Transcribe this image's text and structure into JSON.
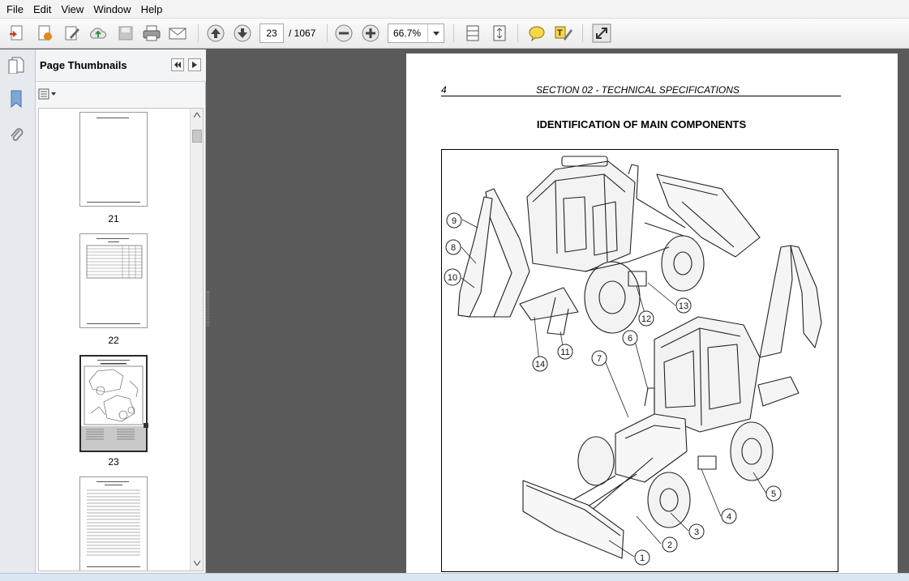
{
  "menu": [
    "File",
    "Edit",
    "View",
    "Window",
    "Help"
  ],
  "toolbar": {
    "current_page": "23",
    "total_pages": "/  1067",
    "zoom": "66.7%"
  },
  "panel": {
    "title": "Page Thumbnails"
  },
  "thumbnails": [
    {
      "label": "21"
    },
    {
      "label": "22"
    },
    {
      "label": "23"
    }
  ],
  "document": {
    "page_number": "4",
    "section_header": "SECTION 02 - TECHNICAL SPECIFICATIONS",
    "title": "IDENTIFICATION OF MAIN COMPONENTS",
    "callouts": [
      "1",
      "2",
      "3",
      "4",
      "5",
      "6",
      "7",
      "8",
      "9",
      "10",
      "11",
      "12",
      "13",
      "14"
    ]
  }
}
